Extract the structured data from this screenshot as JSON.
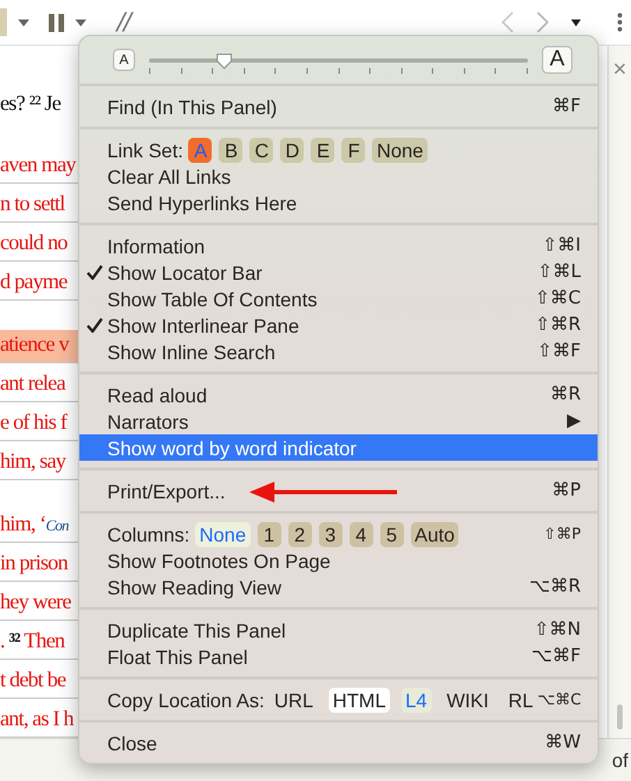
{
  "toolbar": {
    "path_text": "//"
  },
  "document": {
    "paragraphs": [
      {
        "lines": [
          {
            "highlighted": false,
            "segments": [
              {
                "kind": "plain",
                "text": "es? ²² Je"
              }
            ]
          }
        ]
      },
      {
        "lines": [
          {
            "highlighted": false,
            "segments": [
              {
                "kind": "red",
                "text": "aven may"
              }
            ]
          },
          {
            "highlighted": false,
            "segments": [
              {
                "kind": "red",
                "text": "n to settl"
              }
            ]
          },
          {
            "highlighted": false,
            "segments": [
              {
                "kind": "red",
                "text": "could no"
              }
            ]
          },
          {
            "highlighted": false,
            "segments": [
              {
                "kind": "red",
                "text": "d payme"
              }
            ]
          }
        ]
      },
      {
        "lines": [
          {
            "highlighted": true,
            "segments": [
              {
                "kind": "red",
                "text": "atience v"
              }
            ]
          },
          {
            "highlighted": false,
            "segments": [
              {
                "kind": "red",
                "text": "ant relea"
              }
            ]
          },
          {
            "highlighted": false,
            "segments": [
              {
                "kind": "red",
                "text": "e of his f"
              }
            ]
          },
          {
            "highlighted": false,
            "segments": [
              {
                "kind": "red",
                "text": "him, say"
              }
            ]
          }
        ]
      },
      {
        "lines": [
          {
            "highlighted": false,
            "segments": [
              {
                "kind": "red",
                "text": "him, ‘"
              },
              {
                "kind": "quote",
                "text": "Con"
              }
            ]
          },
          {
            "highlighted": false,
            "segments": [
              {
                "kind": "red",
                "text": "in prison"
              }
            ]
          },
          {
            "highlighted": false,
            "segments": [
              {
                "kind": "red",
                "text": "hey were"
              }
            ]
          },
          {
            "highlighted": false,
            "segments": [
              {
                "kind": "red",
                "text": ". "
              },
              {
                "kind": "verse",
                "text": "³²"
              },
              {
                "kind": "red",
                "text": " Then"
              }
            ]
          },
          {
            "highlighted": false,
            "segments": [
              {
                "kind": "red",
                "text": "t debt be"
              }
            ]
          },
          {
            "highlighted": false,
            "segments": [
              {
                "kind": "red",
                "text": "ant, as I h"
              }
            ]
          }
        ]
      }
    ]
  },
  "side_panel": {
    "close": "×",
    "footer_text": "of"
  },
  "menu": {
    "sections": [
      [
        {
          "kind": "slider",
          "small_label": "A",
          "large_label": "A",
          "level": 0.2
        }
      ],
      [
        {
          "kind": "item",
          "label": "Find (In This Panel)",
          "shortcut": "⌘F",
          "checked": false,
          "selected": false
        }
      ],
      [
        {
          "kind": "choices",
          "label": "Link Set:",
          "options": [
            {
              "label": "A",
              "selected": true
            },
            {
              "label": "B",
              "selected": false
            },
            {
              "label": "C",
              "selected": false
            },
            {
              "label": "D",
              "selected": false
            },
            {
              "label": "E",
              "selected": false
            },
            {
              "label": "F",
              "selected": false
            },
            {
              "label": "None",
              "selected": false
            }
          ]
        },
        {
          "kind": "item",
          "label": "Clear All Links",
          "checked": false,
          "selected": false
        },
        {
          "kind": "item",
          "label": "Send Hyperlinks Here",
          "checked": false,
          "selected": false
        }
      ],
      [
        {
          "kind": "item",
          "label": "Information",
          "shortcut": "⇧⌘I",
          "checked": false,
          "selected": false
        },
        {
          "kind": "item",
          "label": "Show Locator Bar",
          "shortcut": "⇧⌘L",
          "checked": true,
          "selected": false
        },
        {
          "kind": "item",
          "label": "Show Table Of Contents",
          "shortcut": "⇧⌘C",
          "checked": false,
          "selected": false
        },
        {
          "kind": "item",
          "label": "Show Interlinear Pane",
          "shortcut": "⇧⌘R",
          "checked": true,
          "selected": false
        },
        {
          "kind": "item",
          "label": "Show Inline Search",
          "shortcut": "⇧⌘F",
          "checked": false,
          "selected": false
        }
      ],
      [
        {
          "kind": "item",
          "label": "Read aloud",
          "shortcut": "⌘R",
          "checked": false,
          "selected": false
        },
        {
          "kind": "item",
          "label": "Narrators",
          "shortcut": "▶",
          "checked": false,
          "selected": false
        },
        {
          "kind": "item",
          "label": "Show word by word indicator",
          "checked": false,
          "selected": true
        }
      ],
      [
        {
          "kind": "item",
          "label": "Print/Export...",
          "shortcut": "⌘P",
          "checked": false,
          "selected": false,
          "annotated": true
        }
      ],
      [
        {
          "kind": "choices",
          "label": "Columns:",
          "shortcut": "⇧⌘P",
          "options": [
            {
              "label": "None",
              "selected": true
            },
            {
              "label": "1",
              "selected": false
            },
            {
              "label": "2",
              "selected": false
            },
            {
              "label": "3",
              "selected": false
            },
            {
              "label": "4",
              "selected": false
            },
            {
              "label": "5",
              "selected": false
            },
            {
              "label": "Auto",
              "selected": false
            }
          ]
        },
        {
          "kind": "item",
          "label": "Show Footnotes On Page",
          "checked": false,
          "selected": false
        },
        {
          "kind": "item",
          "label": "Show Reading View",
          "shortcut": "⌥⌘R",
          "checked": false,
          "selected": false
        }
      ],
      [
        {
          "kind": "item",
          "label": "Duplicate This Panel",
          "shortcut": "⇧⌘N",
          "checked": false,
          "selected": false
        },
        {
          "kind": "item",
          "label": "Float This Panel",
          "shortcut": "⌥⌘F",
          "checked": false,
          "selected": false
        }
      ],
      [
        {
          "kind": "formats",
          "label": "Copy Location As:",
          "shortcut": "⌥⌘C",
          "options": [
            {
              "label": "URL",
              "selected": false,
              "highlighted": false
            },
            {
              "label": "HTML",
              "selected": false,
              "highlighted": true
            },
            {
              "label": "L4",
              "selected": true,
              "highlighted": false
            },
            {
              "label": "WIKI",
              "selected": false,
              "highlighted": false
            },
            {
              "label": "RL",
              "selected": false,
              "highlighted": false
            }
          ]
        }
      ],
      [
        {
          "kind": "item",
          "label": "Close",
          "shortcut": "⌘W",
          "checked": false,
          "selected": false
        }
      ]
    ]
  }
}
